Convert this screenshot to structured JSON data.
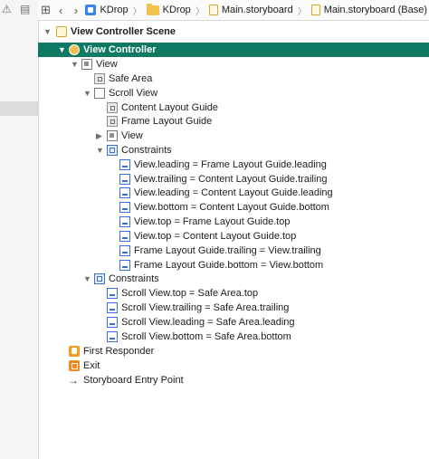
{
  "jumpbar": {
    "items": [
      {
        "label": "KDrop",
        "icon": "project-icon"
      },
      {
        "label": "KDrop",
        "icon": "folder-icon"
      },
      {
        "label": "Main.storyboard",
        "icon": "storyboard-icon"
      },
      {
        "label": "Main.storyboard (Base)",
        "icon": "storyboard-icon"
      }
    ]
  },
  "colors": {
    "selection": "#0f7a64",
    "constraint_blue": "#3b6fd8",
    "storyboard_orange": "#f29b1d"
  },
  "outline": {
    "scene": "View Controller Scene",
    "view_controller": "View Controller",
    "view": "View",
    "safe_area": "Safe Area",
    "scroll_view": "Scroll View",
    "content_layout_guide": "Content Layout Guide",
    "frame_layout_guide": "Frame Layout Guide",
    "inner_view": "View",
    "constraints_inner": "Constraints",
    "inner_constraints": [
      "View.leading = Frame Layout Guide.leading",
      "View.trailing = Content Layout Guide.trailing",
      "View.leading = Content Layout Guide.leading",
      "View.bottom = Content Layout Guide.bottom",
      "View.top = Frame Layout Guide.top",
      "View.top = Content Layout Guide.top",
      "Frame Layout Guide.trailing = View.trailing",
      "Frame Layout Guide.bottom = View.bottom"
    ],
    "constraints_outer": "Constraints",
    "outer_constraints": [
      "Scroll View.top = Safe Area.top",
      "Scroll View.trailing = Safe Area.trailing",
      "Scroll View.leading = Safe Area.leading",
      "Scroll View.bottom = Safe Area.bottom"
    ],
    "first_responder": "First Responder",
    "exit": "Exit",
    "entry_point": "Storyboard Entry Point"
  }
}
